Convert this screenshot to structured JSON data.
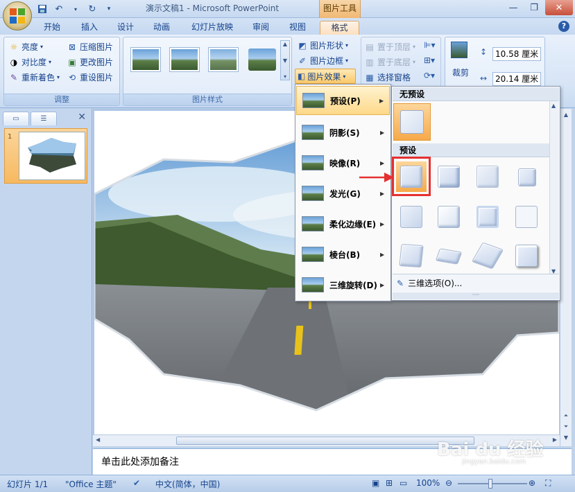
{
  "window": {
    "title": "演示文稿1 - Microsoft PowerPoint",
    "context_tool": "图片工具",
    "min": "—",
    "restore": "❐",
    "close": "✕",
    "help": "?"
  },
  "tabs": [
    "开始",
    "插入",
    "设计",
    "动画",
    "幻灯片放映",
    "审阅",
    "视图",
    "格式"
  ],
  "active_tab": "格式",
  "ribbon": {
    "adjust": {
      "label": "调整",
      "brightness": "亮度",
      "contrast": "对比度",
      "recolor": "重新着色",
      "compress": "压缩图片",
      "change": "更改图片",
      "reset": "重设图片"
    },
    "styles": {
      "label": "图片样式"
    },
    "picture_shape": "图片形状",
    "picture_border": "图片边框",
    "picture_effects": "图片效果",
    "arrange": {
      "bring_front": "置于顶层",
      "send_back": "置于底层",
      "selection_pane": "选择窗格"
    },
    "size": {
      "crop": "裁剪",
      "height": "10.58 厘米",
      "width": "20.14 厘米"
    }
  },
  "effects_menu": [
    {
      "label": "预设(P)",
      "highlight": true
    },
    {
      "label": "阴影(S)"
    },
    {
      "label": "映像(R)"
    },
    {
      "label": "发光(G)"
    },
    {
      "label": "柔化边缘(E)"
    },
    {
      "label": "棱台(B)"
    },
    {
      "label": "三维旋转(D)"
    }
  ],
  "preset_submenu": {
    "no_preset": "无预设",
    "preset": "预设",
    "options": "三维选项(O)..."
  },
  "left_panel": {
    "slide_number": "1"
  },
  "notes_placeholder": "单击此处添加备注",
  "status": {
    "slide": "幻灯片 1/1",
    "theme": "\"Office 主题\"",
    "language": "中文(简体，中国)",
    "zoom": "100%"
  },
  "watermark": {
    "brand": "Bai du 经验",
    "url": "jingyan.baidu.com"
  },
  "colors": {
    "accent": "#f7b960",
    "highlight_border": "#e53030",
    "ribbon_text": "#15428b"
  }
}
